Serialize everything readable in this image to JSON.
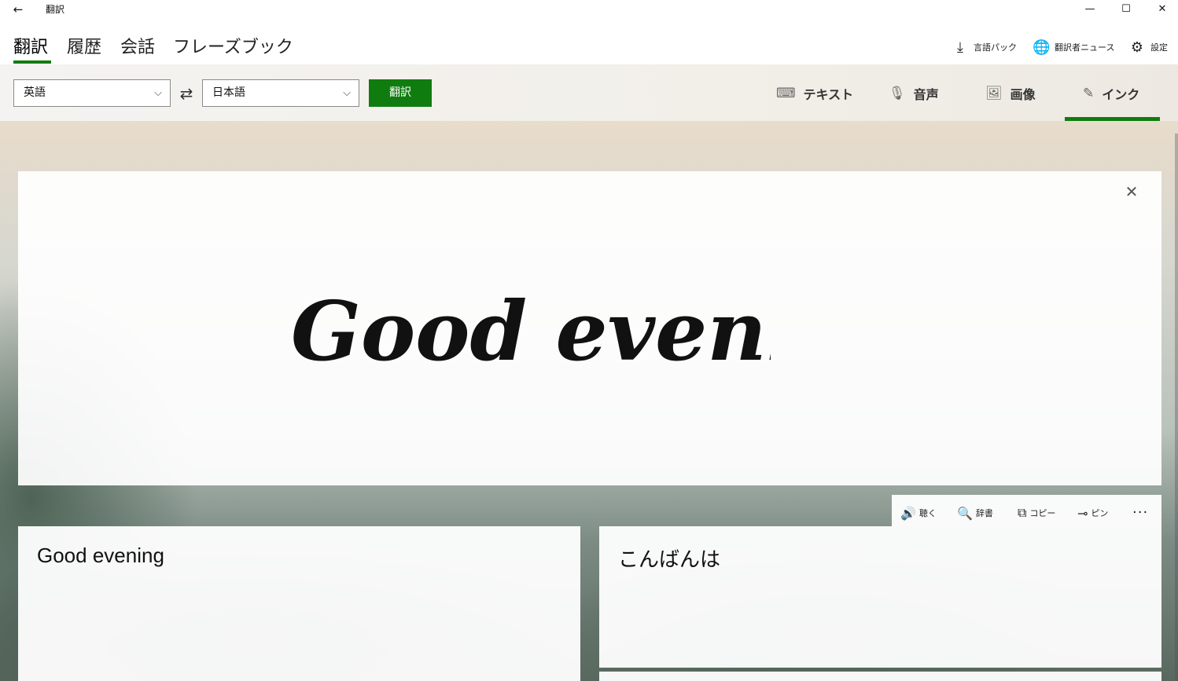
{
  "window": {
    "title": "翻訳",
    "back_icon": "←",
    "minimize_icon": "—",
    "maximize_icon": "☐",
    "close_icon": "✕"
  },
  "nav": {
    "tabs": [
      "翻訳",
      "履歴",
      "会話",
      "フレーズブック"
    ],
    "active_tab": "翻訳"
  },
  "top_actions": [
    {
      "label": "言語パック",
      "icon": "⤓"
    },
    {
      "label": "翻訳者ニュース",
      "icon": "🌐"
    },
    {
      "label": "設定",
      "icon": "⚙"
    }
  ],
  "toolbar": {
    "source_language": "英語",
    "target_language": "日本語",
    "swap_icon": "⇄",
    "chevron_icon": "⌵",
    "translate_label": "翻訳"
  },
  "modes": [
    {
      "label": "テキスト",
      "icon": "⌨"
    },
    {
      "label": "音声",
      "icon": "🎙"
    },
    {
      "label": "画像",
      "icon": "🖼"
    },
    {
      "label": "インク",
      "icon": "✎"
    }
  ],
  "active_mode": "インク",
  "ink": {
    "recognized_handwriting": "Good evening",
    "close_icon": "✕"
  },
  "source": {
    "text": "Good evening"
  },
  "result": {
    "text": "こんばんは",
    "actions": [
      {
        "label": "聴く",
        "icon": "🔊"
      },
      {
        "label": "辞書",
        "icon": "🔍"
      },
      {
        "label": "コピー",
        "icon": "⧉"
      },
      {
        "label": "ピン",
        "icon": "⊸"
      }
    ],
    "more_icon": "···"
  },
  "colors": {
    "accent": "#107c10"
  }
}
